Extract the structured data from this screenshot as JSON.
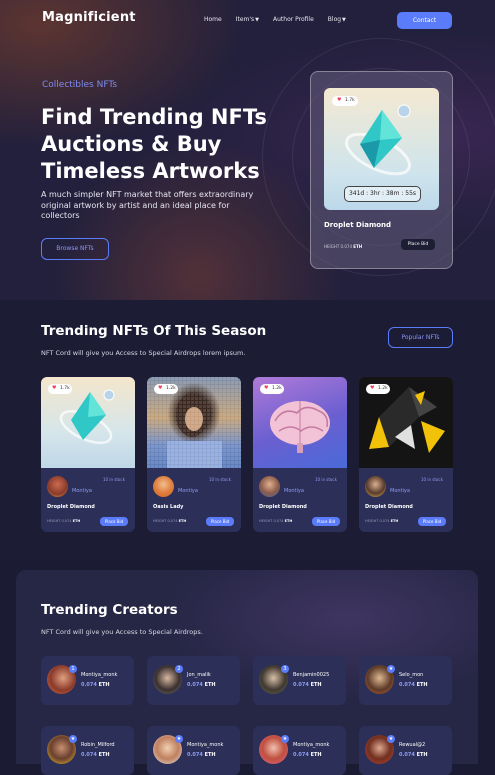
{
  "header": {
    "logo": "Magnificient",
    "nav": [
      "Home",
      "Item's",
      "Author Profile",
      "Blog"
    ],
    "contact": "Contact"
  },
  "hero": {
    "eyebrow": "Collectibles NFTs",
    "title": "Find Trending NFTs Auctions & Buy Timeless Artworks",
    "description": "A much simpler NFT market that offers extraordinary original artwork by artist and an ideal place for collectors",
    "cta": "Browse NFTs",
    "card": {
      "likes": "1.7k",
      "timer": "341d : 3hr : 38m : 55s",
      "title": "Droplet Diamond",
      "height_label": "HEIGHT 0.074",
      "height_unit": "ETH",
      "bid": "Place Bid"
    }
  },
  "trending": {
    "title": "Trending NFTs Of This Season",
    "subtitle": "NFT Cord will give you Access to Special Airdrops lorem ipsum.",
    "button": "Popular NFTs",
    "cards": [
      {
        "likes": "1.7k",
        "stock": "10 in stock",
        "author": "Montiya",
        "title": "Droplet Diamond",
        "height_label": "HEIGHT 0.074",
        "height_unit": "ETH",
        "bid": "Place Bid"
      },
      {
        "likes": "1.2k",
        "stock": "10 in stock",
        "author": "Montiya",
        "title": "Oasis Lady",
        "height_label": "HEIGHT 0.074",
        "height_unit": "ETH",
        "bid": "Place Bid"
      },
      {
        "likes": "1.2k",
        "stock": "10 in stock",
        "author": "Montiya",
        "title": "Droplet Diamond",
        "height_label": "HEIGHT 0.074",
        "height_unit": "ETH",
        "bid": "Place Bid"
      },
      {
        "likes": "1.2k",
        "stock": "10 in stock",
        "author": "Montiya",
        "title": "Droplet Diamond",
        "height_label": "HEIGHT 0.074",
        "height_unit": "ETH",
        "bid": "Place Bid"
      }
    ]
  },
  "creators": {
    "title": "Trending Creators",
    "subtitle": "NFT Cord will give you Access to Special Airdrops.",
    "items": [
      {
        "name": "Montiya_monk",
        "value": "0.074",
        "unit": "ETH",
        "badge": "1"
      },
      {
        "name": "Jon_malik",
        "value": "0.074",
        "unit": "ETH",
        "badge": "2"
      },
      {
        "name": "Benjamin0025",
        "value": "0.074",
        "unit": "ETH",
        "badge": "3"
      },
      {
        "name": "Selo_mon",
        "value": "0.074",
        "unit": "ETH",
        "badge": "★"
      },
      {
        "name": "Robin_Milford",
        "value": "0.074",
        "unit": "ETH",
        "badge": "★"
      },
      {
        "name": "Montiya_monk",
        "value": "0.074",
        "unit": "ETH",
        "badge": "★"
      },
      {
        "name": "Montiya_monk",
        "value": "0.074",
        "unit": "ETH",
        "badge": "★"
      },
      {
        "name": "Rewual@2",
        "value": "0.074",
        "unit": "ETH",
        "badge": "★"
      }
    ]
  },
  "colors": {
    "accent": "#5b7cfa",
    "background": "#1b1b34",
    "card": "#2c3058"
  }
}
